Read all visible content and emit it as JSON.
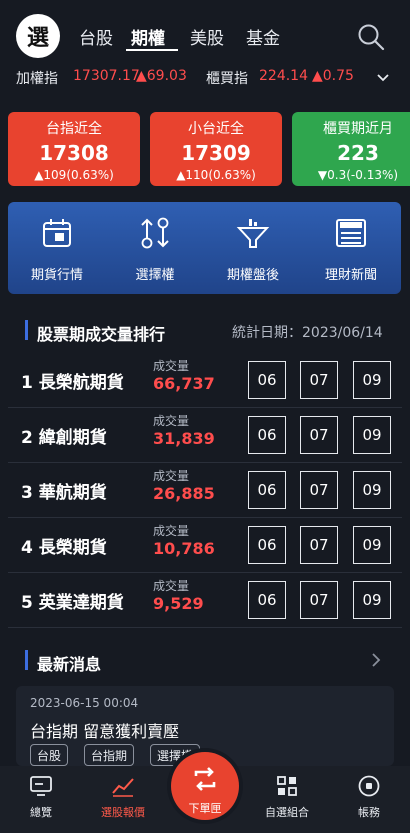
{
  "app": {
    "logo_text": "選"
  },
  "tabs": [
    {
      "label": "台股"
    },
    {
      "label": "期權"
    },
    {
      "label": "美股"
    },
    {
      "label": "基金"
    }
  ],
  "ticker": {
    "a_name": "加權指",
    "a_value": "17307.17",
    "a_change": "▲69.03",
    "b_name": "櫃買指",
    "b_value": "224.14",
    "b_change": "▲0.75"
  },
  "cards": [
    {
      "title": "台指近全",
      "value": "17308",
      "change": "▲109(0.63%)"
    },
    {
      "title": "小台近全",
      "value": "17309",
      "change": "▲110(0.63%)"
    },
    {
      "title": "櫃買期近月",
      "value": "223",
      "change": "▼0.3(-0.13%)"
    }
  ],
  "services": [
    {
      "label": "期貨行情",
      "icon": "calendar-icon"
    },
    {
      "label": "選擇權",
      "icon": "options-arrows-icon"
    },
    {
      "label": "期權盤後",
      "icon": "funnel-chart-icon"
    },
    {
      "label": "理財新聞",
      "icon": "newspaper-icon"
    }
  ],
  "ranking": {
    "title": "股票期成交量排行",
    "date_label": "統計日期：2023/06/14",
    "volume_label": "成交量",
    "rows": [
      {
        "name": "1 長榮航期貨",
        "volume": "66,737",
        "months": [
          "06",
          "07",
          "09"
        ]
      },
      {
        "name": "2 緯創期貨",
        "volume": "31,839",
        "months": [
          "06",
          "07",
          "09"
        ]
      },
      {
        "name": "3 華航期貨",
        "volume": "26,885",
        "months": [
          "06",
          "07",
          "09"
        ]
      },
      {
        "name": "4 長榮期貨",
        "volume": "10,786",
        "months": [
          "06",
          "07",
          "09"
        ]
      },
      {
        "name": "5 英業達期貨",
        "volume": "9,529",
        "months": [
          "06",
          "07",
          "09"
        ]
      }
    ]
  },
  "news": {
    "title": "最新消息",
    "item": {
      "time": "2023-06-15 00:04",
      "headline": "台指期 留意獲利賣壓",
      "tags": [
        "台股",
        "台指期",
        "選擇權"
      ]
    }
  },
  "bottom_nav": [
    {
      "label": "總覽",
      "icon": "monitor-icon"
    },
    {
      "label": "選股報價",
      "icon": "trend-chart-icon"
    },
    {
      "label": "下單匣",
      "icon": "order-refresh-icon"
    },
    {
      "label": "自選組合",
      "icon": "grid-icon"
    },
    {
      "label": "帳務",
      "icon": "account-circle-icon"
    }
  ],
  "colors": {
    "up": "#ff4d4d",
    "down_card": "#2fa64e",
    "up_card": "#e8432f",
    "accent": "#3d6ee0"
  }
}
